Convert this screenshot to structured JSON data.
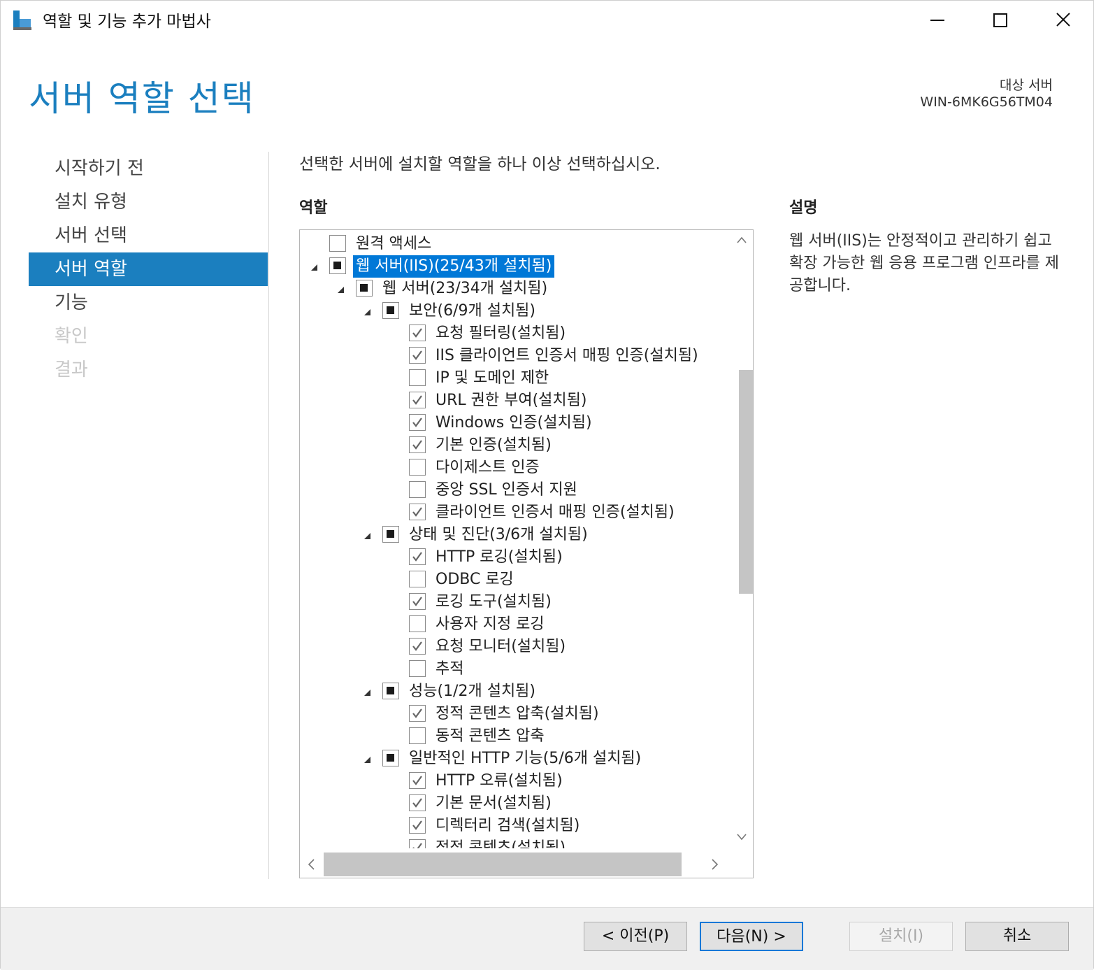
{
  "window": {
    "title": "역할 및 기능 추가 마법사"
  },
  "header": {
    "page_title": "서버 역할 선택",
    "target_label": "대상 서버",
    "target_name": "WIN-6MK6G56TM04"
  },
  "nav": {
    "items": [
      {
        "label": "시작하기 전",
        "state": "normal"
      },
      {
        "label": "설치 유형",
        "state": "normal"
      },
      {
        "label": "서버 선택",
        "state": "normal"
      },
      {
        "label": "서버 역할",
        "state": "active"
      },
      {
        "label": "기능",
        "state": "normal"
      },
      {
        "label": "확인",
        "state": "disabled"
      },
      {
        "label": "결과",
        "state": "disabled"
      }
    ]
  },
  "main": {
    "instruction": "선택한 서버에 설치할 역할을 하나 이상 선택하십시오.",
    "roles_label": "역할",
    "description_label": "설명",
    "description_text": "웹 서버(IIS)는 안정적이고 관리하기 쉽고 확장 가능한 웹 응용 프로그램 인프라를 제공합니다."
  },
  "tree": [
    {
      "label": "원격 액세스",
      "level": 0,
      "state": "unchecked",
      "expander": false,
      "selected": false
    },
    {
      "label": "웹 서버(IIS)(25/43개 설치됨)",
      "level": 0,
      "state": "partial",
      "expander": true,
      "selected": true
    },
    {
      "label": "웹 서버(23/34개 설치됨)",
      "level": 1,
      "state": "partial",
      "expander": true,
      "selected": false
    },
    {
      "label": "보안(6/9개 설치됨)",
      "level": 2,
      "state": "partial",
      "expander": true,
      "selected": false
    },
    {
      "label": "요청 필터링(설치됨)",
      "level": 3,
      "state": "checked",
      "expander": false,
      "selected": false
    },
    {
      "label": "IIS 클라이언트 인증서 매핑 인증(설치됨)",
      "level": 3,
      "state": "checked",
      "expander": false,
      "selected": false
    },
    {
      "label": "IP 및 도메인 제한",
      "level": 3,
      "state": "unchecked",
      "expander": false,
      "selected": false
    },
    {
      "label": "URL 권한 부여(설치됨)",
      "level": 3,
      "state": "checked",
      "expander": false,
      "selected": false
    },
    {
      "label": "Windows 인증(설치됨)",
      "level": 3,
      "state": "checked",
      "expander": false,
      "selected": false
    },
    {
      "label": "기본 인증(설치됨)",
      "level": 3,
      "state": "checked",
      "expander": false,
      "selected": false
    },
    {
      "label": "다이제스트 인증",
      "level": 3,
      "state": "unchecked",
      "expander": false,
      "selected": false
    },
    {
      "label": "중앙 SSL 인증서 지원",
      "level": 3,
      "state": "unchecked",
      "expander": false,
      "selected": false
    },
    {
      "label": "클라이언트 인증서 매핑 인증(설치됨)",
      "level": 3,
      "state": "checked",
      "expander": false,
      "selected": false
    },
    {
      "label": "상태 및 진단(3/6개 설치됨)",
      "level": 2,
      "state": "partial",
      "expander": true,
      "selected": false
    },
    {
      "label": "HTTP 로깅(설치됨)",
      "level": 3,
      "state": "checked",
      "expander": false,
      "selected": false
    },
    {
      "label": "ODBC 로깅",
      "level": 3,
      "state": "unchecked",
      "expander": false,
      "selected": false
    },
    {
      "label": "로깅 도구(설치됨)",
      "level": 3,
      "state": "checked",
      "expander": false,
      "selected": false
    },
    {
      "label": "사용자 지정 로깅",
      "level": 3,
      "state": "unchecked",
      "expander": false,
      "selected": false
    },
    {
      "label": "요청 모니터(설치됨)",
      "level": 3,
      "state": "checked",
      "expander": false,
      "selected": false
    },
    {
      "label": "추적",
      "level": 3,
      "state": "unchecked",
      "expander": false,
      "selected": false
    },
    {
      "label": "성능(1/2개 설치됨)",
      "level": 2,
      "state": "partial",
      "expander": true,
      "selected": false
    },
    {
      "label": "정적 콘텐츠 압축(설치됨)",
      "level": 3,
      "state": "checked",
      "expander": false,
      "selected": false
    },
    {
      "label": "동적 콘텐츠 압축",
      "level": 3,
      "state": "unchecked",
      "expander": false,
      "selected": false
    },
    {
      "label": "일반적인 HTTP 기능(5/6개 설치됨)",
      "level": 2,
      "state": "partial",
      "expander": true,
      "selected": false
    },
    {
      "label": "HTTP 오류(설치됨)",
      "level": 3,
      "state": "checked",
      "expander": false,
      "selected": false
    },
    {
      "label": "기본 문서(설치됨)",
      "level": 3,
      "state": "checked",
      "expander": false,
      "selected": false
    },
    {
      "label": "디렉터리 검색(설치됨)",
      "level": 3,
      "state": "checked",
      "expander": false,
      "selected": false
    },
    {
      "label": "정적 콘텐츠(설치됨)",
      "level": 3,
      "state": "checked",
      "expander": false,
      "selected": false
    }
  ],
  "buttons": {
    "previous": "< 이전(P)",
    "next": "다음(N) >",
    "install": "설치(I)",
    "cancel": "취소"
  }
}
